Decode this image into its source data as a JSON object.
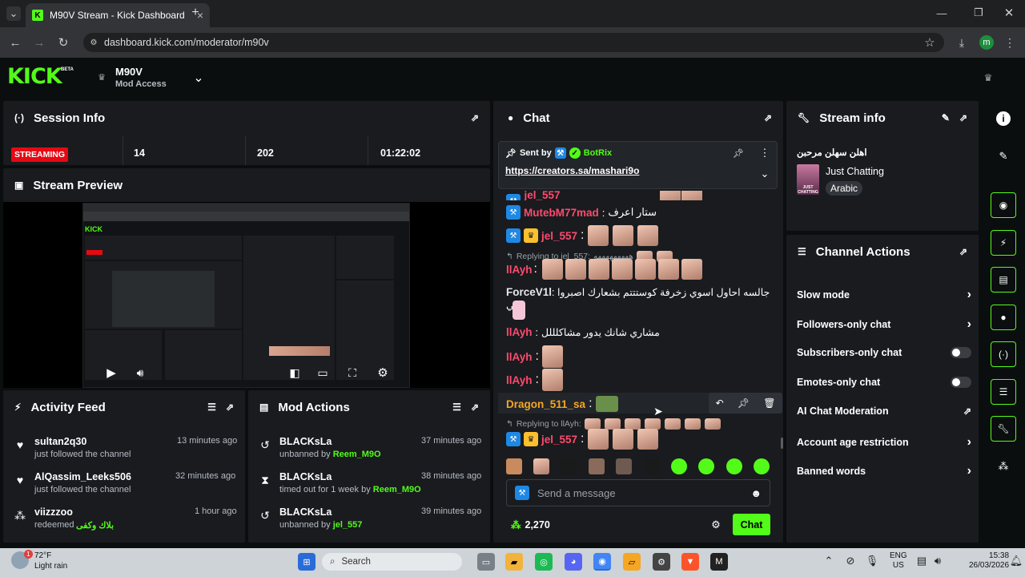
{
  "browser": {
    "tab_title": "M90V Stream - Kick Dashboard",
    "url": "dashboard.kick.com/moderator/m90v",
    "profile_initial": "m"
  },
  "kick": {
    "logo": "KICK",
    "beta": "BETA",
    "channel_name": "M90V",
    "access_label": "Mod Access"
  },
  "session_info": {
    "title": "Session Info",
    "status": "STREAMING",
    "stat1": "14",
    "stat2": "202",
    "uptime": "01:22:02"
  },
  "stream_preview": {
    "title": "Stream Preview"
  },
  "activity_feed": {
    "title": "Activity Feed",
    "items": [
      {
        "user": "sultan2q30",
        "text": "just followed the channel",
        "time": "13 minutes ago"
      },
      {
        "user": "AlQassim_Leeks506",
        "text": "just followed the channel",
        "time": "32 minutes ago"
      },
      {
        "user": "viizzzoo",
        "text": "redeemed",
        "reward": "بلاك وكفى",
        "time": "1 hour ago"
      }
    ]
  },
  "mod_actions": {
    "title": "Mod Actions",
    "items": [
      {
        "user": "BLACKsLa",
        "text": "unbanned by",
        "by": "Reem_M9O",
        "time": "37 minutes ago"
      },
      {
        "user": "BLACKsLa",
        "text": "timed out for 1 week by",
        "by": "Reem_M9O",
        "time": "38 minutes ago"
      },
      {
        "user": "BLACKsLa",
        "text": "unbanned by",
        "by": "jel_557",
        "time": "39 minutes ago"
      }
    ]
  },
  "chat": {
    "title": "Chat",
    "pinned": {
      "sent_by_label": "Sent by",
      "sender": "BotRix",
      "link": "https://creators.sa/mashari9o"
    },
    "partial_user": "jel_557",
    "messages": [
      {
        "user": "MutebM77mad",
        "text": "ستار اعرف"
      },
      {
        "user": "jel_557",
        "text": ""
      },
      {
        "reply": "Replying to jel_557:",
        "reply_text": "هههههههههه"
      },
      {
        "user": "llAyh",
        "text": ""
      },
      {
        "user": "ForceV1l",
        "text": "جالسه احاول اسوي زخرفة كوستتتم بشعارك اصبروا ليبي"
      },
      {
        "user": "llAyh",
        "text": "مشاري شانك يدور مشاكلللل"
      },
      {
        "user": "llAyh",
        "text": ""
      },
      {
        "user": "llAyh",
        "text": ""
      },
      {
        "user": "Dragon_511_sa",
        "text": ""
      },
      {
        "reply": "Replying to llAyh:",
        "reply_text": ""
      },
      {
        "user": "jel_557",
        "text": ""
      }
    ],
    "input_placeholder": "Send a message",
    "points": "2,270",
    "send_label": "Chat"
  },
  "stream_info": {
    "title": "Stream info",
    "stream_title": "اهلن سهلن مرحبن",
    "category": "Just Chatting",
    "tag": "Arabic",
    "thumb_caption": "JUST CHATTING"
  },
  "channel_actions": {
    "title": "Channel Actions",
    "items": [
      {
        "label": "Slow mode",
        "control": "chevron"
      },
      {
        "label": "Followers-only chat",
        "control": "chevron"
      },
      {
        "label": "Subscribers-only chat",
        "control": "toggle"
      },
      {
        "label": "Emotes-only chat",
        "control": "toggle"
      },
      {
        "label": "AI Chat Moderation",
        "control": "external"
      },
      {
        "label": "Account age restriction",
        "control": "chevron"
      },
      {
        "label": "Banned words",
        "control": "chevron"
      }
    ]
  },
  "taskbar": {
    "weather_temp": "72°F",
    "weather_desc": "Light rain",
    "weather_badge": "1",
    "search_label": "Search",
    "lang_line1": "ENG",
    "lang_line2": "US",
    "clock_time": "15:38",
    "clock_date": "26/03/2026"
  },
  "colors": {
    "kick_green": "#53fc18",
    "panel_bg": "#191b1f",
    "username_red": "#ff4a6d",
    "streaming_red": "#e50914"
  }
}
